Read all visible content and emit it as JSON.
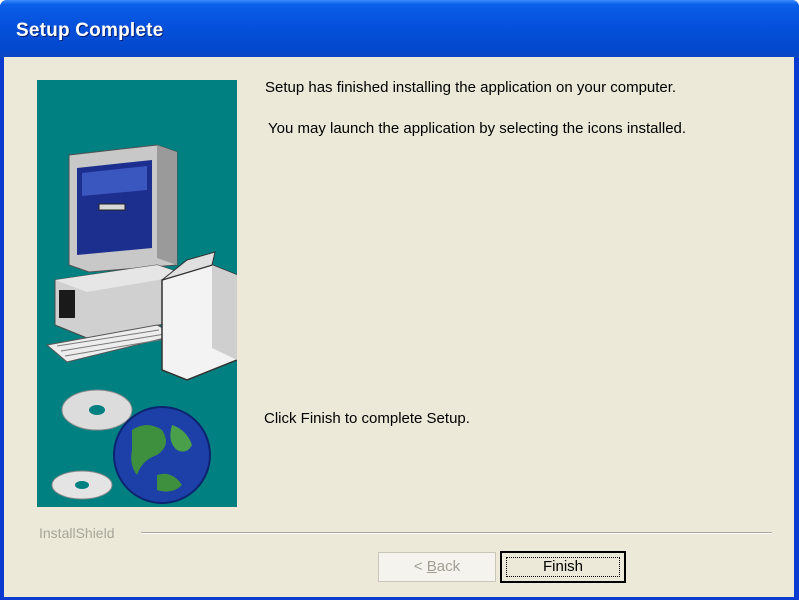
{
  "window": {
    "title": "Setup Complete"
  },
  "content": {
    "line1": "Setup has finished installing the application on your computer.",
    "line2": "You may launch the application by selecting the icons installed.",
    "line3": "Click Finish to complete Setup."
  },
  "footer": {
    "brand_label": "InstallShield"
  },
  "buttons": {
    "back_prefix": "< ",
    "back_accel": "B",
    "back_rest": "ack",
    "back_enabled": false,
    "finish_label": "Finish"
  },
  "colors": {
    "side_panel": "#008080",
    "dialog_bg": "#ece9d8",
    "titlebar": "#0652dd"
  },
  "icons": {
    "illustration": "computer-and-globe-illustration"
  }
}
